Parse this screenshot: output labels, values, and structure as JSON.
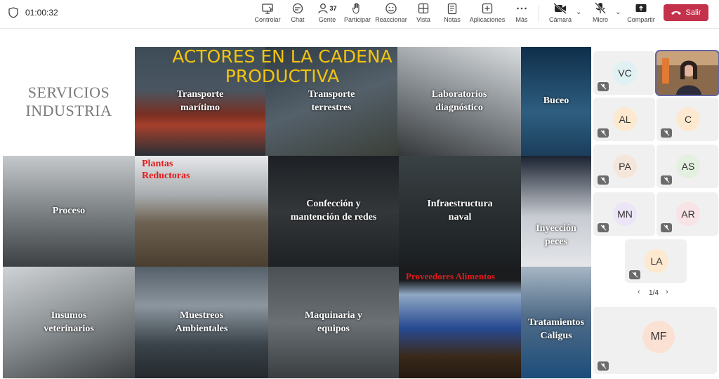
{
  "toolbar": {
    "timer": "01:00:32",
    "controlar": "Controlar",
    "chat": "Chat",
    "gente": "Gente",
    "gente_count": "37",
    "participar": "Participar",
    "reaccionar": "Reaccionar",
    "vista": "Vista",
    "notas": "Notas",
    "aplicaciones": "Aplicaciones",
    "mas": "Más",
    "camara": "Cámara",
    "micro": "Micro",
    "compartir": "Compartir",
    "salir": "Salir",
    "leave_color": "#c4314b"
  },
  "slide": {
    "services_line1": "SERVICIOS",
    "services_line2": "INDUSTRIA",
    "title_line1": "ACTORES EN LA CADENA",
    "title_line2": "PRODUCTIVA",
    "title_color": "#f2c40f",
    "tiles": {
      "transporte_maritimo": [
        "Transporte",
        "marítimo"
      ],
      "transporte_terrestre": [
        "Transporte",
        "terrestres"
      ],
      "laboratorios": [
        "Laboratorios",
        "diagnóstico"
      ],
      "buceo": "Buceo",
      "proceso": "Proceso",
      "plantas": [
        "Plantas",
        "Reductoras"
      ],
      "redes": [
        "Confección y",
        "mantención de redes"
      ],
      "infraestructura": [
        "Infraestructura",
        "naval"
      ],
      "inyeccion": [
        "Inyección",
        "peces"
      ],
      "insumos": [
        "Insumos",
        "veterinarios"
      ],
      "muestreos": [
        "Muestreos",
        "Ambientales"
      ],
      "maquinaria": [
        "Maquinaria y",
        "equipos"
      ],
      "proveedores": "Proveedores Alimentos",
      "caligus": [
        "Tratamientos",
        "Caligus"
      ]
    }
  },
  "participants": {
    "tiles": [
      {
        "initials": "VC",
        "color": "#dff1f2"
      },
      {
        "initials": "AL",
        "color": "#fde9cf"
      },
      {
        "initials": "C",
        "color": "#fde9cf"
      },
      {
        "initials": "PA",
        "color": "#f5e6dc"
      },
      {
        "initials": "AS",
        "color": "#e3f0e0"
      },
      {
        "initials": "MN",
        "color": "#ece5f6"
      },
      {
        "initials": "AR",
        "color": "#f8e3e6"
      },
      {
        "initials": "LA",
        "color": "#fde9cf"
      },
      {
        "initials": "MF",
        "color": "#fbe1d3"
      }
    ],
    "page": "1/4"
  }
}
